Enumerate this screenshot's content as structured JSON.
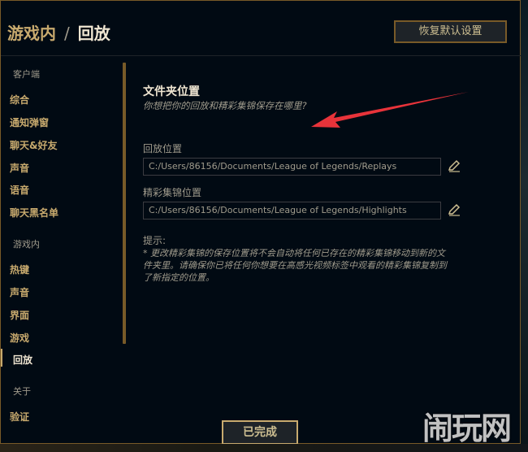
{
  "breadcrumb": {
    "parent": "游戏内",
    "separator": "/",
    "current": "回放"
  },
  "header": {
    "reset_label": "恢复默认设置"
  },
  "sidebar": {
    "client_section": "客户端",
    "client_items": [
      "综合",
      "通知弹窗",
      "聊天&好友",
      "声音",
      "语音",
      "聊天黑名单"
    ],
    "ingame_section": "游戏内",
    "ingame_items": [
      "热键",
      "声音",
      "界面",
      "游戏",
      "回放"
    ],
    "about_section": "关于",
    "about_items": [
      "验证"
    ],
    "active_item": "回放"
  },
  "content": {
    "title": "文件夹位置",
    "subtitle": "你想把你的回放和精彩集锦保存在哪里?",
    "replay_label": "回放位置",
    "replay_path": "C:/Users/86156/Documents/League of Legends/Replays",
    "highlights_label": "精彩集锦位置",
    "highlights_path": "C:/Users/86156/Documents/League of Legends/Highlights",
    "hint_label": "提示:",
    "hint_text": "* 更改精彩集锦的保存位置将不会自动将任何已存在的精彩集锦移动到新的文件夹里。请确保你已将任何你想要在高感光视频标签中观看的精彩集锦复制到了新指定的位置。"
  },
  "footer": {
    "done_label": "已完成"
  },
  "watermark": "闹玩网",
  "colors": {
    "gold": "#c8aa6e",
    "gold_dark": "#785a28",
    "arrow": "#e8333a",
    "bg": "#010a13"
  }
}
